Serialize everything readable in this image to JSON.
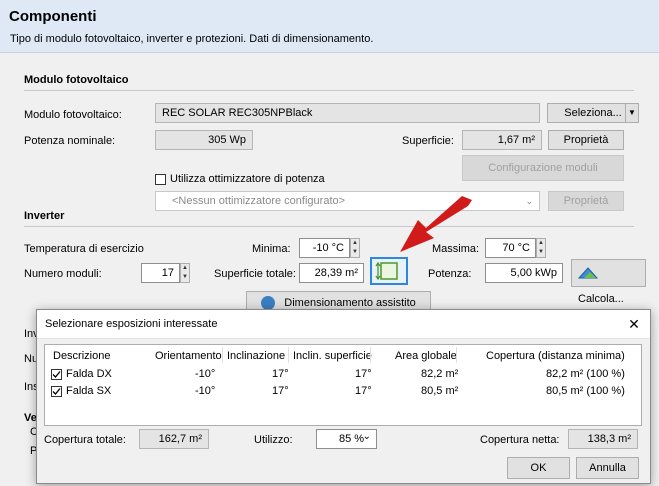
{
  "header": {
    "title": "Componenti",
    "subtitle": "Tipo di modulo fotovoltaico, inverter e protezioni. Dati di dimensionamento."
  },
  "modulo": {
    "section_title": "Modulo fotovoltaico",
    "label": "Modulo fotovoltaico:",
    "value": "REC SOLAR REC305NPBlack",
    "select_button": "Seleziona...",
    "dropdown_glyph": "▼",
    "potenza_label": "Potenza nominale:",
    "potenza_value": "305 Wp",
    "superficie_label": "Superficie:",
    "superficie_value": "1,67 m²",
    "proprieta_button": "Proprietà",
    "config_button": "Configurazione moduli",
    "ottimizzatore_label": "Utilizza ottimizzatore di potenza",
    "ottimizzatore_checked": false,
    "ottimizzatore_combo": "<Nessun ottimizzatore configurato>",
    "ottimizzatore_proprieta": "Proprietà"
  },
  "inverter": {
    "section_title": "Inverter",
    "temp_label": "Temperatura di esercizio",
    "minima_label": "Minima:",
    "minima_value": "-10 °C",
    "massima_label": "Massima:",
    "massima_value": "70 °C",
    "numero_label": "Numero moduli:",
    "numero_value": "17",
    "superficie_totale_label": "Superficie totale:",
    "superficie_totale_value": "28,39 m²",
    "potenza_label": "Potenza:",
    "potenza_value": "5,00 kWp",
    "calcola_button": "Calcola...",
    "dimensionamento_button": "Dimensionamento assistito"
  },
  "behind": {
    "fragments": [
      "Inv",
      "Nu",
      "Ins",
      "Ve",
      "C",
      "P"
    ]
  },
  "dialog": {
    "title": "Selezionare esposizioni interessate",
    "close_glyph": "✕",
    "columns": [
      "Descrizione",
      "Orientamento",
      "Inclinazione",
      "Inclin. superficie",
      "Area globale",
      "Copertura (distanza minima)"
    ],
    "rows": [
      {
        "checked": true,
        "descrizione": "Falda DX",
        "orientamento": "-10°",
        "inclinazione": "17°",
        "inclin_superficie": "17°",
        "area": "82,2 m²",
        "copertura": "82,2 m² (100 %)"
      },
      {
        "checked": true,
        "descrizione": "Falda SX",
        "orientamento": "-10°",
        "inclinazione": "17°",
        "inclin_superficie": "17°",
        "area": "80,5 m²",
        "copertura": "80,5 m² (100 %)"
      }
    ],
    "copertura_totale_label": "Copertura totale:",
    "copertura_totale_value": "162,7 m²",
    "utilizzo_label": "Utilizzo:",
    "utilizzo_value": "85 %",
    "copertura_netta_label": "Copertura netta:",
    "copertura_netta_value": "138,3 m²",
    "ok_button": "OK",
    "annulla_button": "Annulla"
  },
  "colors": {
    "header_bg": "#dfe9f5",
    "arrow": "#d11a1a",
    "highlight_border": "#2e86de"
  },
  "icons": [
    "resize-icon",
    "calculator-icon",
    "gear-icon",
    "close-icon",
    "red-arrow-icon"
  ]
}
